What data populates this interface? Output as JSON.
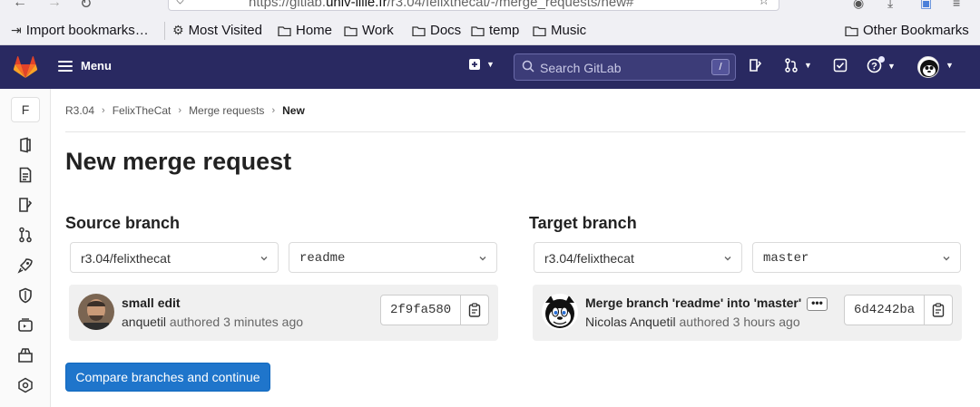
{
  "browser": {
    "url_prefix": "https://gitlab.",
    "url_domain": "univ-lille.fr",
    "url_path": "/r3.04/felixthecat/-/merge_requests/new#"
  },
  "bookmarks": {
    "items": [
      {
        "label": "Import bookmarks…",
        "icon": "import-icon"
      },
      {
        "label": "Most Visited",
        "icon": "gear-icon"
      },
      {
        "label": "Home",
        "icon": "folder-icon"
      },
      {
        "label": "Work",
        "icon": "folder-icon"
      },
      {
        "label": "Docs",
        "icon": "folder-icon"
      },
      {
        "label": "temp",
        "icon": "folder-icon"
      },
      {
        "label": "Music",
        "icon": "folder-icon"
      }
    ],
    "other": "Other Bookmarks"
  },
  "topnav": {
    "menu_label": "Menu",
    "search_placeholder": "Search GitLab",
    "search_shortcut": "/",
    "bg_color": "#292961"
  },
  "sidebar": {
    "project_initial": "F"
  },
  "breadcrumb": {
    "items": [
      "R3.04",
      "FelixTheCat",
      "Merge requests"
    ],
    "current": "New"
  },
  "page": {
    "title": "New merge request",
    "compare_button": "Compare branches and continue"
  },
  "source": {
    "heading": "Source branch",
    "project": "r3.04/felixthecat",
    "branch": "readme",
    "commit": {
      "title": "small edit",
      "author": "anquetil",
      "authored": " authored 3 minutes ago",
      "sha": "2f9fa580"
    }
  },
  "target": {
    "heading": "Target branch",
    "project": "r3.04/felixthecat",
    "branch": "master",
    "commit": {
      "title": "Merge branch 'readme' into 'master'",
      "author": "Nicolas Anquetil",
      "authored": " authored 3 hours ago",
      "sha": "6d4242ba",
      "more": "•••"
    }
  }
}
